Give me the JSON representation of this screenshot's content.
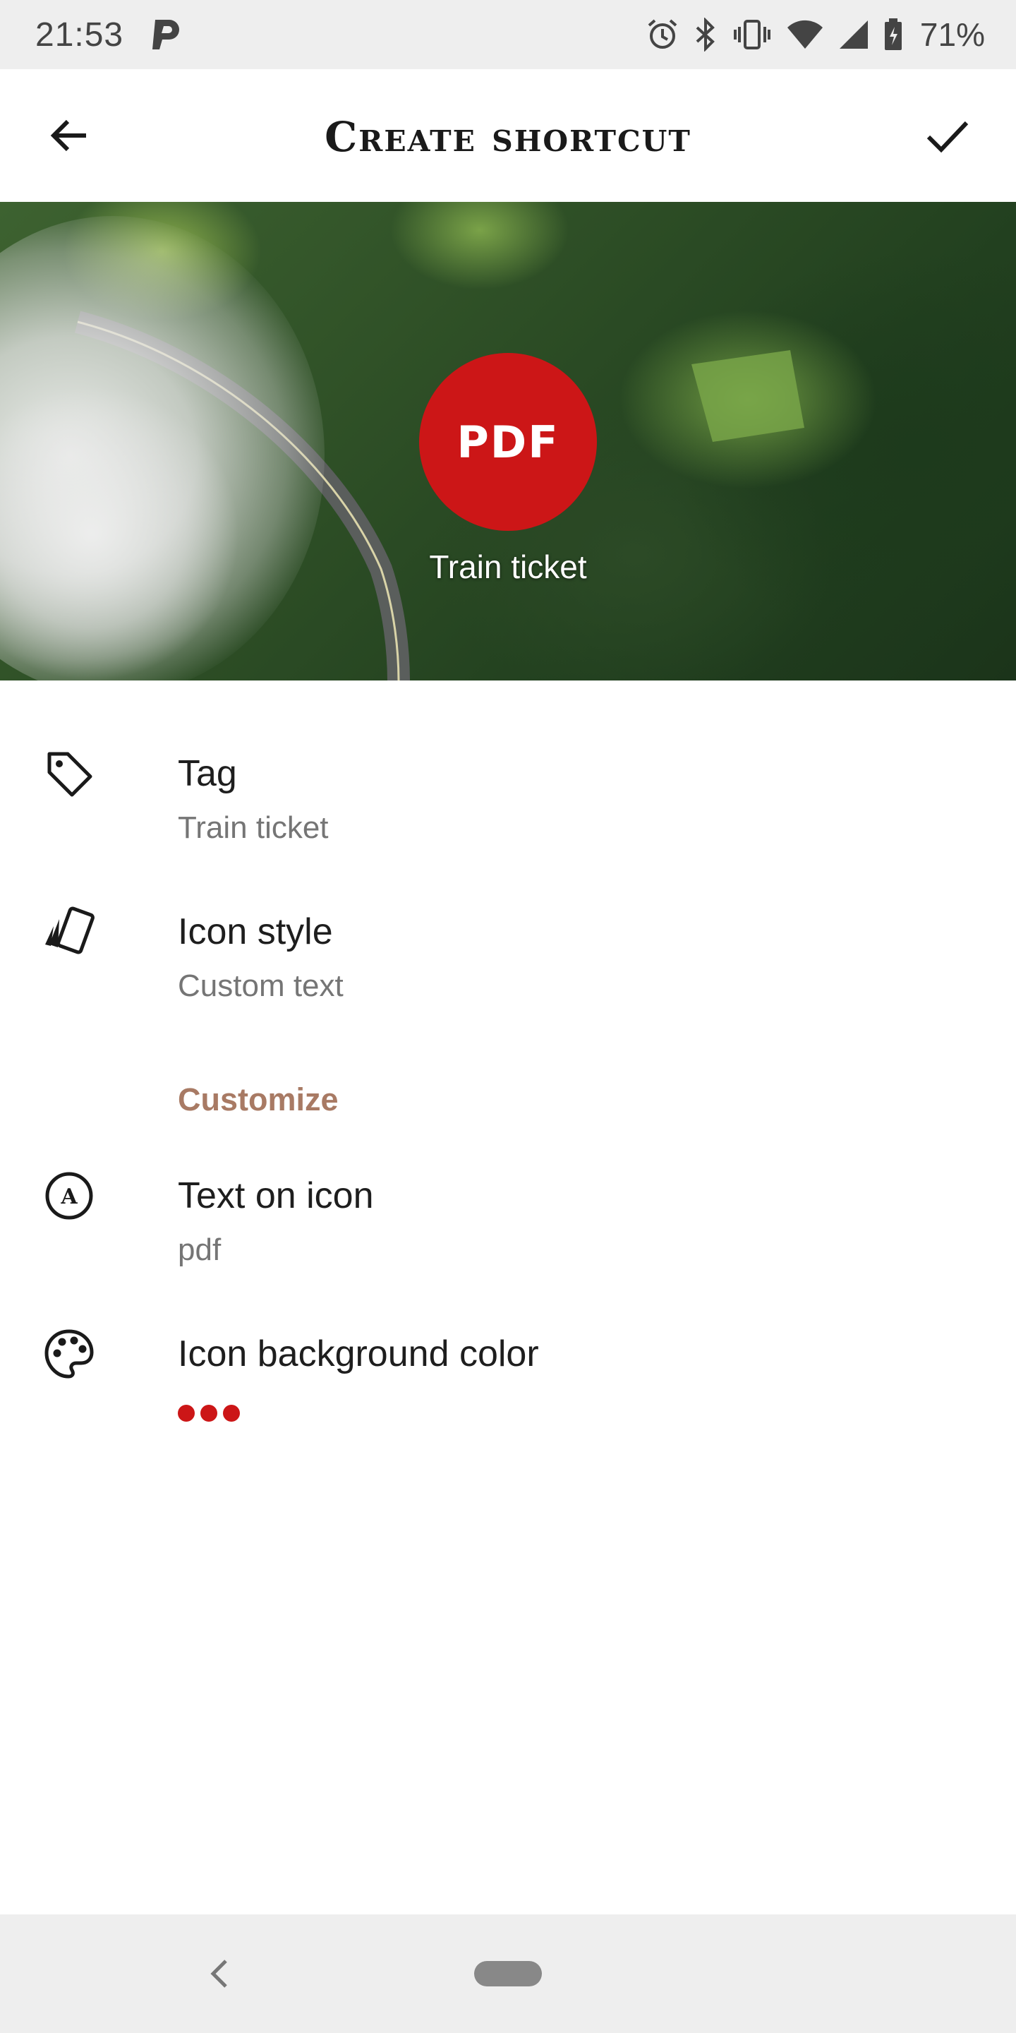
{
  "status_bar": {
    "time": "21:53",
    "battery_percent": "71%",
    "icons": [
      "parking-app-icon",
      "alarm-icon",
      "bluetooth-icon",
      "vibrate-icon",
      "wifi-icon",
      "cell-signal-icon",
      "battery-icon"
    ]
  },
  "app_bar": {
    "title": "Create shortcut",
    "back_icon": "arrow-back-icon",
    "confirm_icon": "check-icon"
  },
  "preview": {
    "icon_text": "PDF",
    "icon_color": "#cc1617",
    "label": "Train ticket"
  },
  "settings": {
    "tag": {
      "title": "Tag",
      "value": "Train ticket",
      "icon": "tag-icon"
    },
    "icon_style": {
      "title": "Icon style",
      "value": "Custom text",
      "icon": "card-stack-icon"
    },
    "section_header": "Customize",
    "text_on_icon": {
      "title": "Text on icon",
      "value": "pdf",
      "icon": "circle-letter-a-icon"
    },
    "background_color": {
      "title": "Icon background color",
      "icon": "palette-icon",
      "swatch_color": "#cc1617"
    }
  },
  "nav_bar": {
    "back_icon": "nav-back-icon",
    "home_icon": "home-pill-icon"
  }
}
